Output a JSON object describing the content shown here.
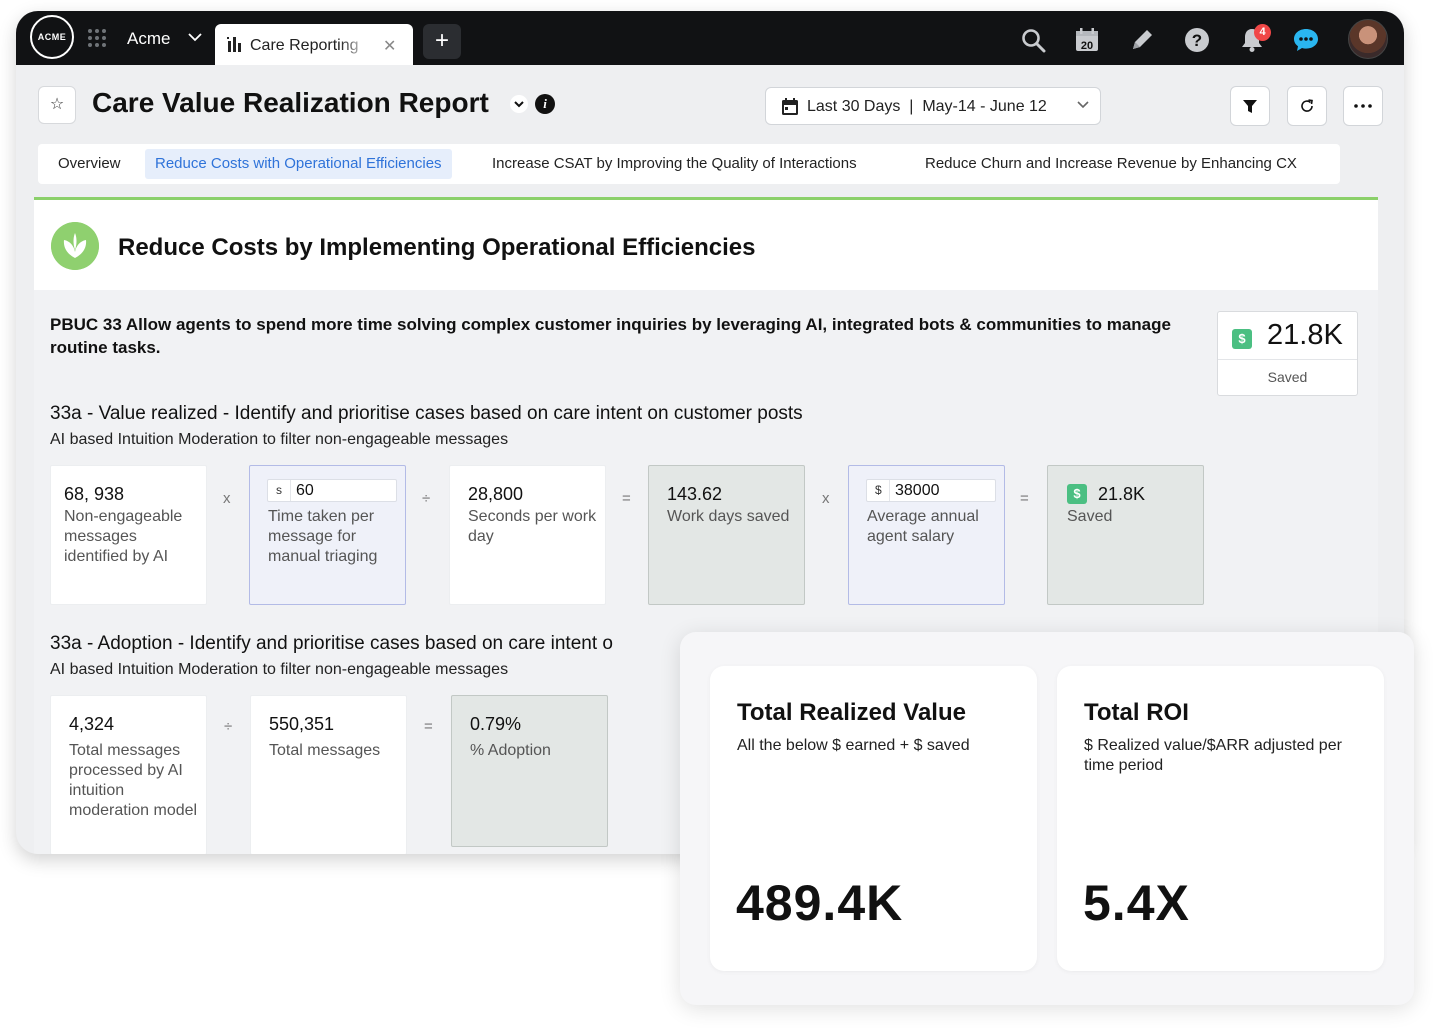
{
  "topbar": {
    "logo_text": "ACME",
    "workspace": "Acme",
    "active_tab": "Care Reporting",
    "add_tab": "+",
    "calendar_day": "20",
    "notification_count": "4",
    "icons": [
      "apps-grid-icon",
      "search-icon",
      "calendar-icon",
      "pencil-icon",
      "help-icon",
      "bell-icon",
      "chat-icon"
    ]
  },
  "header": {
    "title": "Care Value Realization Report",
    "date_range": "Last 30 Days  |  May-14 - June 12"
  },
  "report_tabs": [
    {
      "label": "Overview",
      "active": false
    },
    {
      "label": "Reduce Costs with Operational Efficiencies",
      "active": true
    },
    {
      "label": "Increase CSAT by Improving the Quality of Interactions",
      "active": false
    },
    {
      "label": "Reduce Churn and Increase Revenue by Enhancing CX",
      "active": false
    }
  ],
  "section": {
    "title": "Reduce Costs by Implementing Operational Efficiencies",
    "accent_color": "#8bd06a",
    "pbuc": "PBUC 33 Allow agents to spend more time solving complex customer inquiries by leveraging AI, integrated bots & communities to manage routine tasks.",
    "saved_card": {
      "value": "21.8K",
      "label": "Saved",
      "currency": "$"
    }
  },
  "value_realized": {
    "heading": "33a - Value realized - Identify and prioritise cases based on care intent on customer posts",
    "description": "AI based Intuition Moderation to filter non-engageable messages",
    "cards": [
      {
        "value": "68, 938",
        "label": "Non-engageable messages identified by AI"
      },
      {
        "currency": "s",
        "input": "60",
        "label": "Time taken per message for manual triaging"
      },
      {
        "value": "28,800",
        "label": "Seconds per work day"
      },
      {
        "value": "143.62",
        "label": "Work days saved"
      },
      {
        "currency": "$",
        "input": "38000",
        "label": "Average annual agent salary"
      },
      {
        "currency": "$",
        "value": "21.8K",
        "label": "Saved"
      }
    ],
    "operators": [
      "x",
      "÷",
      "=",
      "x",
      "="
    ]
  },
  "adoption": {
    "heading": "33a - Adoption - Identify and prioritise cases based on care intent o",
    "description": "AI based Intuition Moderation to filter non-engageable messages",
    "cards": [
      {
        "value": "4,324",
        "label": "Total messages processed by AI intuition moderation model"
      },
      {
        "value": "550,351",
        "label": "Total messages"
      },
      {
        "value": "0.79%",
        "label": "% Adoption"
      }
    ],
    "operators": [
      "÷",
      "="
    ]
  },
  "summary": {
    "realized": {
      "title": "Total Realized Value",
      "subtitle": "All the below $ earned + $ saved",
      "value": "489.4K"
    },
    "roi": {
      "title": "Total ROI",
      "subtitle": "$ Realized value/$ARR adjusted per time period",
      "value": "5.4X"
    }
  }
}
